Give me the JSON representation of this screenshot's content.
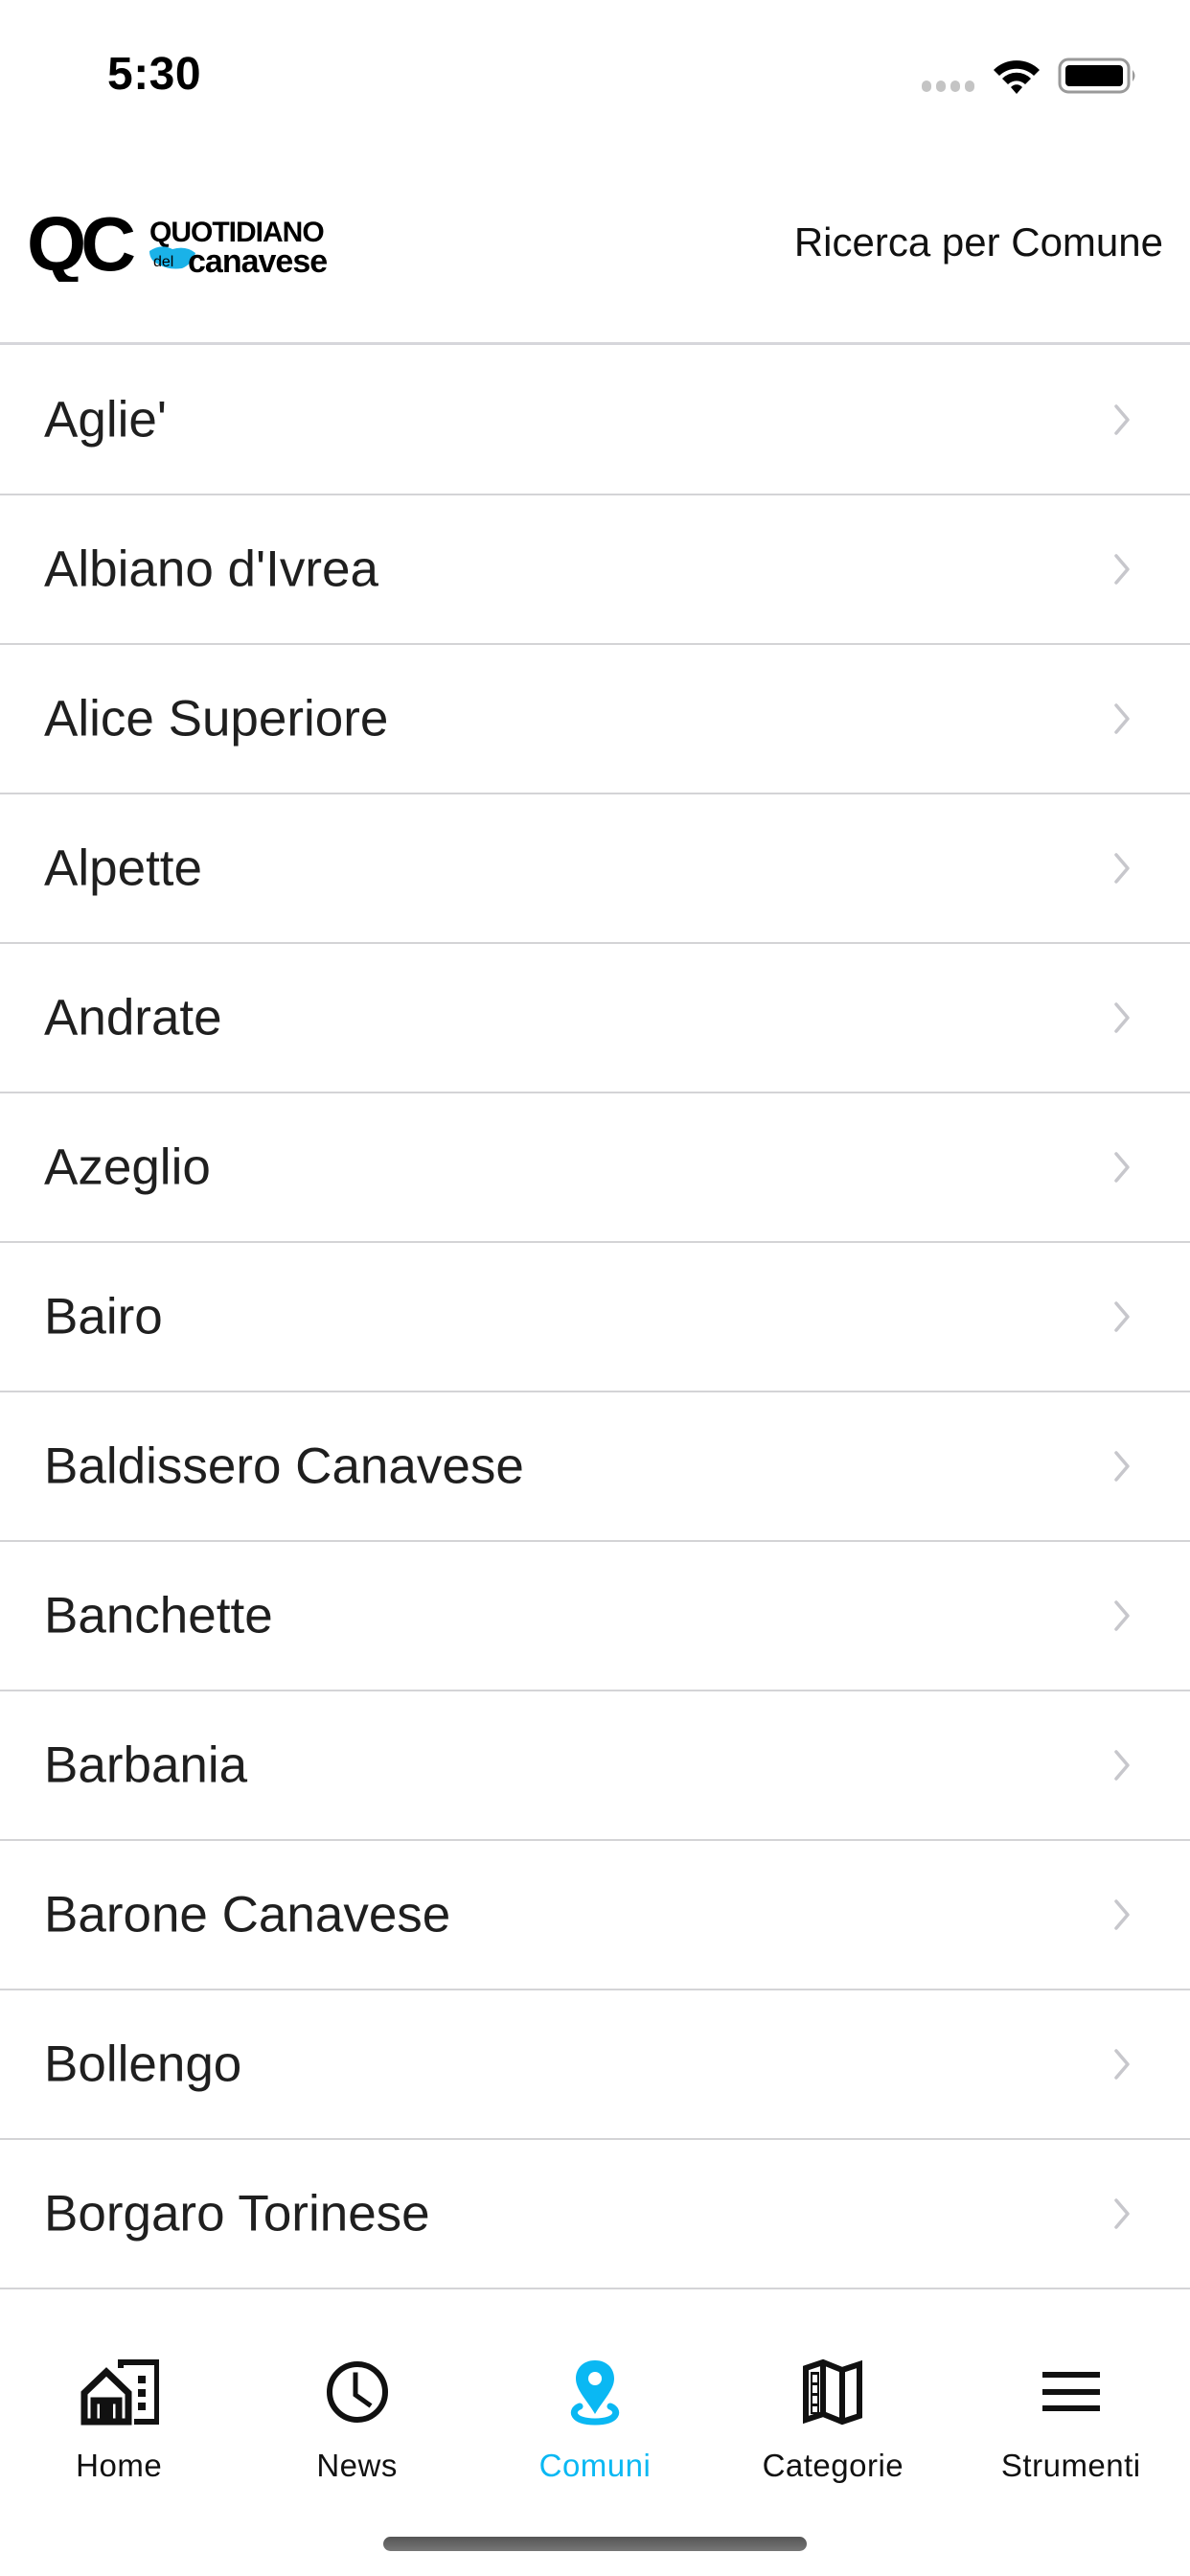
{
  "status_bar": {
    "time": "5:30",
    "icons": [
      "signal-icon",
      "wifi-icon",
      "battery-icon"
    ]
  },
  "header": {
    "logo": {
      "mark": "QC",
      "line1": "QUOTIDIANO",
      "small": "del",
      "line2": "canavese"
    },
    "title": "Ricerca per Comune"
  },
  "list": {
    "items": [
      {
        "label": "Aglie'"
      },
      {
        "label": "Albiano d'Ivrea"
      },
      {
        "label": "Alice Superiore"
      },
      {
        "label": "Alpette"
      },
      {
        "label": "Andrate"
      },
      {
        "label": "Azeglio"
      },
      {
        "label": "Bairo"
      },
      {
        "label": "Baldissero Canavese"
      },
      {
        "label": "Banchette"
      },
      {
        "label": "Barbania"
      },
      {
        "label": "Barone Canavese"
      },
      {
        "label": "Bollengo"
      },
      {
        "label": "Borgaro Torinese"
      }
    ],
    "row_icon": "chevron-right-icon"
  },
  "tab_bar": {
    "active_index": 2,
    "items": [
      {
        "label": "Home",
        "icon": "home-buildings-icon"
      },
      {
        "label": "News",
        "icon": "clock-icon"
      },
      {
        "label": "Comuni",
        "icon": "location-pin-icon"
      },
      {
        "label": "Categorie",
        "icon": "map-icon"
      },
      {
        "label": "Strumenti",
        "icon": "menu-icon"
      }
    ]
  },
  "colors": {
    "accent": "#0AB8F3",
    "text": "#1F1F1F",
    "separator": "#D4D4D6",
    "chevron": "#C7C7CC"
  }
}
